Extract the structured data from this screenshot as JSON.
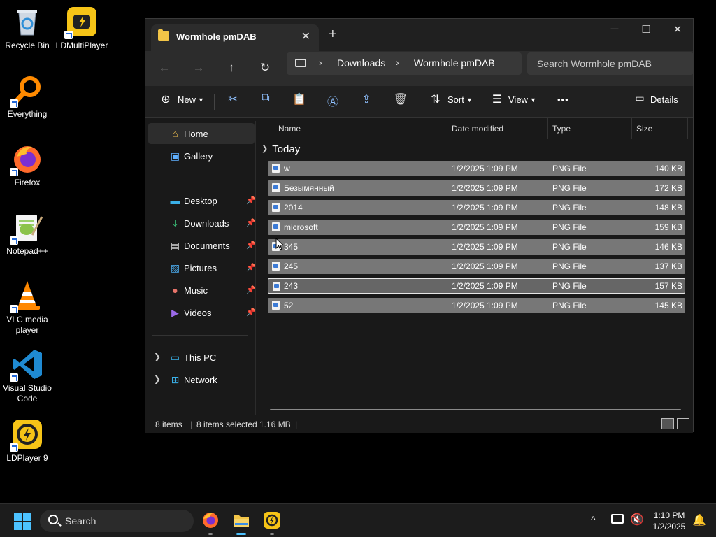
{
  "desktop": {
    "icons": [
      {
        "label": "Recycle Bin"
      },
      {
        "label": "LDMultiPlayer"
      },
      {
        "label": "Everything"
      },
      {
        "label": "Firefox"
      },
      {
        "label": "Notepad++"
      },
      {
        "label": "VLC media player"
      },
      {
        "label": "Visual Studio Code"
      },
      {
        "label": "LDPlayer 9"
      }
    ]
  },
  "window": {
    "tab_title": "Wormhole pmDAB",
    "tab_close": "✕",
    "new_tab": "+",
    "controls": {
      "minimize": "─",
      "maximize": "☐",
      "close": "✕"
    },
    "nav": {
      "back": "←",
      "forward": "→",
      "up": "↑",
      "refresh": "↻"
    },
    "breadcrumb": [
      "Downloads",
      "Wormhole pmDAB"
    ],
    "breadcrumb_sep": "›",
    "search_placeholder": "Search Wormhole pmDAB",
    "toolbar": {
      "new_label": "New",
      "sort_label": "Sort",
      "view_label": "View",
      "more": "•••",
      "details_label": "Details"
    },
    "sidebar": {
      "items": [
        {
          "label": "Home",
          "icon": "home-icon"
        },
        {
          "label": "Gallery",
          "icon": "gallery-icon"
        },
        {
          "label": "Desktop",
          "icon": "desktop-icon"
        },
        {
          "label": "Downloads",
          "icon": "download-icon"
        },
        {
          "label": "Documents",
          "icon": "documents-icon"
        },
        {
          "label": "Pictures",
          "icon": "pictures-icon"
        },
        {
          "label": "Music",
          "icon": "music-icon"
        },
        {
          "label": "Videos",
          "icon": "videos-icon"
        },
        {
          "label": "This PC",
          "icon": "pc-icon"
        },
        {
          "label": "Network",
          "icon": "network-icon"
        }
      ]
    },
    "columns": [
      "Name",
      "Date modified",
      "Type",
      "Size"
    ],
    "group_label": "Today",
    "files": [
      {
        "name": "w",
        "date": "1/2/2025 1:09 PM",
        "type": "PNG File",
        "size": "140 KB"
      },
      {
        "name": "Безымянный",
        "date": "1/2/2025 1:09 PM",
        "type": "PNG File",
        "size": "172 KB"
      },
      {
        "name": "2014",
        "date": "1/2/2025 1:09 PM",
        "type": "PNG File",
        "size": "148 KB"
      },
      {
        "name": "microsoft",
        "date": "1/2/2025 1:09 PM",
        "type": "PNG File",
        "size": "159 KB"
      },
      {
        "name": "345",
        "date": "1/2/2025 1:09 PM",
        "type": "PNG File",
        "size": "146 KB"
      },
      {
        "name": "245",
        "date": "1/2/2025 1:09 PM",
        "type": "PNG File",
        "size": "137 KB"
      },
      {
        "name": "243",
        "date": "1/2/2025 1:09 PM",
        "type": "PNG File",
        "size": "157 KB"
      },
      {
        "name": "52",
        "date": "1/2/2025 1:09 PM",
        "type": "PNG File",
        "size": "145 KB"
      }
    ],
    "status": {
      "item_count": "8 items",
      "selected": "8 items selected",
      "selected_size": "1.16 MB"
    }
  },
  "taskbar": {
    "search_placeholder": "Search",
    "tray_chevron": "^",
    "time": "1:10 PM",
    "date": "1/2/2025"
  },
  "colors": {
    "accent": "#4cc2ff",
    "row_selected": "#777777",
    "window_bg": "#191919"
  }
}
